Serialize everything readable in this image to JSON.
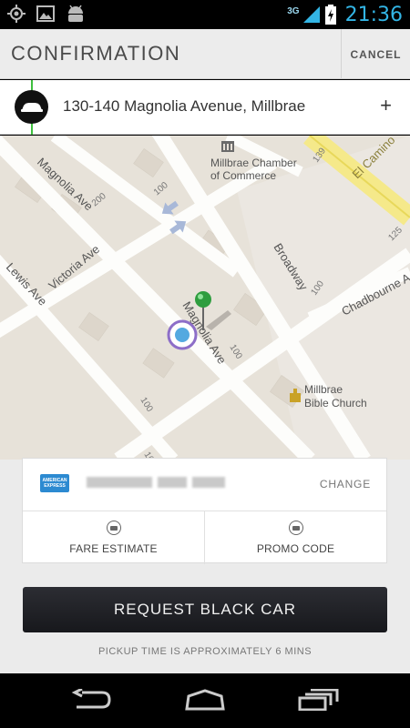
{
  "status_bar": {
    "network": "3G",
    "time": "21:36"
  },
  "header": {
    "title": "CONFIRMATION",
    "cancel_label": "CANCEL"
  },
  "pickup": {
    "address": "130-140 Magnolia Avenue, Millbrae",
    "add_label": "+"
  },
  "map": {
    "labels": {
      "magnolia_ave_top": "Magnolia Ave",
      "magnolia_ave_center": "Magnolia Ave",
      "victoria_ave": "Victoria Ave",
      "lewis_ave": "Lewis Ave",
      "broadway": "Broadway",
      "chadbourne": "Chadbourne A",
      "el_camino": "El Camino",
      "chamber_line1": "Millbrae Chamber",
      "chamber_line2": "of Commerce",
      "church_line1": "Millbrae",
      "church_line2": "Bible Church",
      "n200": "200",
      "n100a": "100",
      "n100b": "100",
      "n100c": "100",
      "n100d": "100",
      "n139": "139",
      "n125": "125",
      "n100e": "100"
    }
  },
  "payment": {
    "card_brand": "AMERICAN EXPRESS",
    "change_label": "CHANGE"
  },
  "options": {
    "fare_estimate": "FARE ESTIMATE",
    "promo_code": "PROMO CODE"
  },
  "request_button": "REQUEST BLACK CAR",
  "pickup_time": "PICKUP TIME IS APPROXIMATELY 6 MINS",
  "colors": {
    "accent_blue": "#33b5e5",
    "pin_green": "#2e9d3e",
    "route_green": "#3fbf3f"
  }
}
